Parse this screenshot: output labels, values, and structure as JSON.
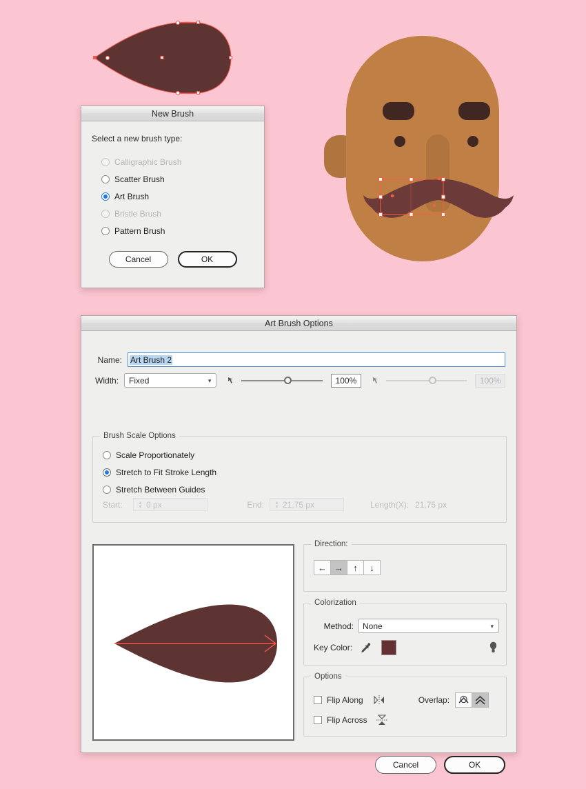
{
  "canvas": {
    "background_color": "#fbc6d1",
    "artwork_shape_color": "#5e3433",
    "face": {
      "skin_color": "#bf7f45",
      "skin_shadow_color": "#b0743f",
      "feature_color": "#402722",
      "mustache_color": "#6b3a39",
      "selection_color": "#f1613f"
    }
  },
  "new_brush_dialog": {
    "title": "New Brush",
    "prompt": "Select a new brush type:",
    "options": [
      {
        "label": "Calligraphic Brush",
        "selected": false,
        "disabled": true
      },
      {
        "label": "Scatter Brush",
        "selected": false,
        "disabled": false
      },
      {
        "label": "Art Brush",
        "selected": true,
        "disabled": false,
        "focused": true
      },
      {
        "label": "Bristle Brush",
        "selected": false,
        "disabled": true
      },
      {
        "label": "Pattern Brush",
        "selected": false,
        "disabled": false
      }
    ],
    "cancel_label": "Cancel",
    "ok_label": "OK"
  },
  "art_brush_options": {
    "title": "Art Brush Options",
    "name_label": "Name:",
    "name_value": "Art Brush 2",
    "width_label": "Width:",
    "width_value": "Fixed",
    "width_options": [
      "Fixed"
    ],
    "width_percent_1": "100%",
    "width_percent_2": "100%",
    "brush_scale": {
      "legend": "Brush Scale Options",
      "options": [
        {
          "label": "Scale Proportionately",
          "selected": false
        },
        {
          "label": "Stretch to Fit Stroke Length",
          "selected": true
        },
        {
          "label": "Stretch Between Guides",
          "selected": false
        }
      ],
      "start_label": "Start:",
      "start_value": "0 px",
      "end_label": "End:",
      "end_value": "21,75 px",
      "length_label": "Length(X):",
      "length_value": "21,75 px"
    },
    "direction": {
      "legend": "Direction:",
      "buttons": [
        {
          "icon": "arrow-left-icon",
          "glyph": "←",
          "active": false
        },
        {
          "icon": "arrow-right-icon",
          "glyph": "→",
          "active": true
        },
        {
          "icon": "arrow-up-icon",
          "glyph": "↑",
          "active": false
        },
        {
          "icon": "arrow-down-icon",
          "glyph": "↓",
          "active": false
        }
      ]
    },
    "colorization": {
      "legend": "Colorization",
      "method_label": "Method:",
      "method_value": "None",
      "method_options": [
        "None"
      ],
      "key_color_label": "Key Color:",
      "key_color_value": "#633033",
      "eyedropper_icon": "eyedropper-icon",
      "tip_icon": "lightbulb-icon"
    },
    "options": {
      "legend": "Options",
      "flip_along_label": "Flip Along",
      "flip_along_checked": false,
      "flip_across_label": "Flip Across",
      "flip_across_checked": false,
      "overlap_label": "Overlap:",
      "overlap_buttons": [
        {
          "icon": "no-overlap-icon",
          "active": false
        },
        {
          "icon": "overlap-icon",
          "active": true
        }
      ]
    },
    "preview": {
      "shape_color": "#5e3433",
      "direction_arrow_color": "#f4564f"
    },
    "cancel_label": "Cancel",
    "ok_label": "OK"
  }
}
